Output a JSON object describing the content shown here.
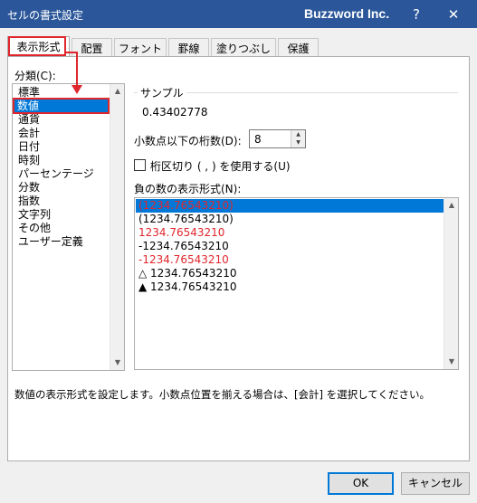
{
  "window": {
    "title": "セルの書式設定",
    "brand": "Buzzword Inc.",
    "help_label": "?",
    "close_label": "✕"
  },
  "tabs": [
    {
      "label": "表示形式",
      "active": true
    },
    {
      "label": "配置"
    },
    {
      "label": "フォント"
    },
    {
      "label": "罫線"
    },
    {
      "label": "塗りつぶし"
    },
    {
      "label": "保護"
    }
  ],
  "category": {
    "label": "分類(C):",
    "items": [
      "標準",
      "数値",
      "通貨",
      "会計",
      "日付",
      "時刻",
      "パーセンテージ",
      "分数",
      "指数",
      "文字列",
      "その他",
      "ユーザー定義"
    ],
    "selected_index": 1
  },
  "sample": {
    "title": "サンプル",
    "value": "0.43402778"
  },
  "decimals": {
    "label": "小数点以下の桁数(D):",
    "value": "8"
  },
  "separator": {
    "label": "桁区切り ( , ) を使用する(U)",
    "checked": false
  },
  "negative": {
    "label": "負の数の表示形式(N):",
    "items": [
      {
        "text": "(1234.76543210)",
        "color": "#e0262d",
        "selected": true
      },
      {
        "text": "(1234.76543210)",
        "color": "#000000"
      },
      {
        "text": "1234.76543210",
        "color": "#e0262d"
      },
      {
        "text": "-1234.76543210",
        "color": "#000000"
      },
      {
        "text": "-1234.76543210",
        "color": "#e0262d"
      },
      {
        "text": "△ 1234.76543210",
        "color": "#000000"
      },
      {
        "text": "▲ 1234.76543210",
        "color": "#000000"
      }
    ]
  },
  "description": "数値の表示形式を設定します。小数点位置を揃える場合は、[会計] を選択してください。",
  "buttons": {
    "ok": "OK",
    "cancel": "キャンセル"
  },
  "colors": {
    "titlebar": "#2b579a",
    "selection": "#0078d7",
    "annotation": "#e0262d"
  }
}
